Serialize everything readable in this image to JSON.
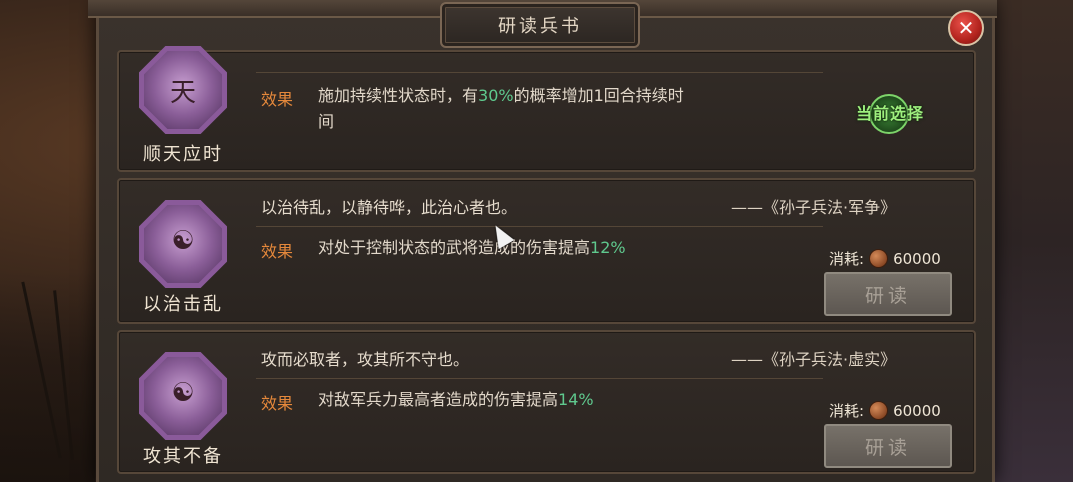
{
  "dialog": {
    "title": "研读兵书",
    "close_icon": "close-icon"
  },
  "skills": [
    {
      "name": "顺天应时",
      "emblem_glyph": "天",
      "effect_label": "效果",
      "effect_prefix": "施加持续性状态时，有",
      "effect_highlight": "30%",
      "effect_suffix_line1": "的概率增加1回合持续时",
      "effect_suffix_line2": "间",
      "status": "当前选择"
    },
    {
      "name": "以治击乱",
      "emblem_glyph": "☯",
      "quote": "以治待乱，以静待哗，此治心者也。",
      "quote_source": "——《孙子兵法·军争》",
      "effect_label": "效果",
      "effect_prefix": "对处于控制状态的武将造成的伤害提高",
      "effect_highlight": "12%",
      "cost_label": "消耗:",
      "cost_value": "60000",
      "button_label": "研读"
    },
    {
      "name": "攻其不备",
      "emblem_glyph": "☯",
      "quote": "攻而必取者，攻其所不守也。",
      "quote_source": "——《孙子兵法·虚实》",
      "effect_label": "效果",
      "effect_prefix": "对敌军兵力最高者造成的伤害提高",
      "effect_highlight": "14%",
      "cost_label": "消耗:",
      "cost_value": "60000",
      "button_label": "研读"
    }
  ],
  "colors": {
    "effect_label": "#e5883b",
    "highlight": "#5fc98e",
    "current_badge": "#9ef07e",
    "close_button": "#b2231d"
  }
}
